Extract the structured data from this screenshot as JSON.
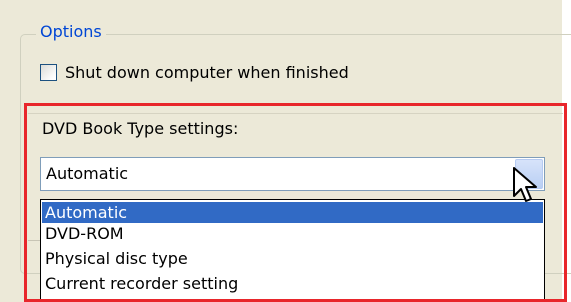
{
  "options": {
    "legend": "Options",
    "shutdown_label": "Shut down computer when finished",
    "shutdown_checked": false
  },
  "book_type": {
    "label": "DVD Book Type settings:",
    "selected": "Automatic",
    "items": [
      "Automatic",
      "DVD-ROM",
      "Physical disc type",
      "Current recorder setting"
    ]
  },
  "colors": {
    "highlight_border": "#e8262b",
    "legend_text": "#0046d5",
    "selection": "#316ac5"
  }
}
